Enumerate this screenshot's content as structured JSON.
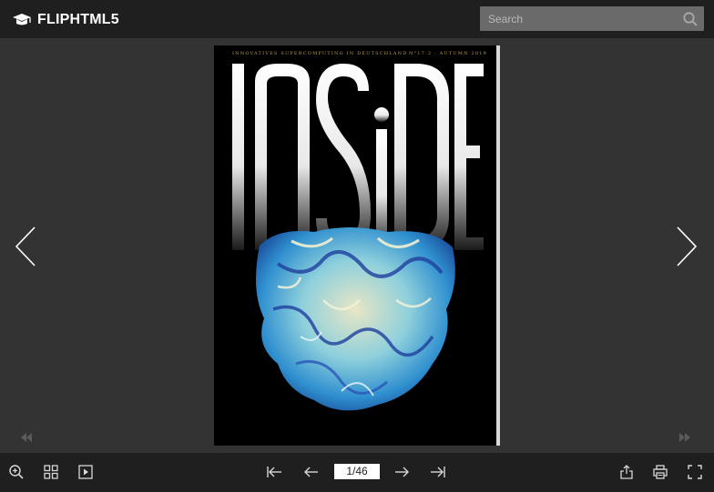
{
  "app": {
    "logo_text": "FLIPHTML5"
  },
  "search": {
    "placeholder": "Search",
    "value": ""
  },
  "cover": {
    "tagline_left": "INNOVATIVES SUPERCOMPUTING IN DEUTSCHLAND",
    "tagline_right": "N°17·2 · AUTUMN 2019",
    "title": "INSiDE"
  },
  "pager": {
    "current_page": "1/46"
  },
  "colors": {
    "bar_bg": "#1f1f1f",
    "stage_bg": "#333333",
    "search_bg": "#6a6a6a",
    "tagline_gold": "#b79c54"
  },
  "icons": {
    "top": [
      "logo-cap-icon",
      "search-icon"
    ],
    "stage": [
      "chevron-left-icon",
      "chevron-right-icon",
      "skip-first-icon",
      "skip-last-icon"
    ],
    "bottom_left": [
      "zoom-in-icon",
      "thumbnails-icon",
      "autoplay-icon"
    ],
    "bottom_center": [
      "first-page-icon",
      "previous-page-icon",
      "next-page-icon",
      "last-page-icon"
    ],
    "bottom_right": [
      "share-icon",
      "print-icon",
      "fullscreen-icon"
    ]
  }
}
